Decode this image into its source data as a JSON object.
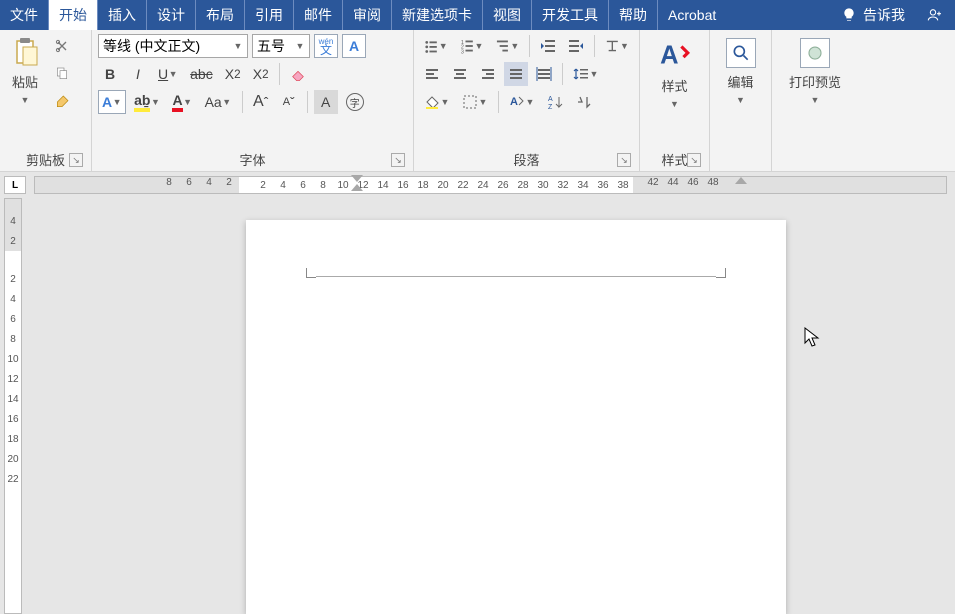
{
  "tabs": {
    "file": "文件",
    "home": "开始",
    "insert": "插入",
    "design": "设计",
    "layout": "布局",
    "references": "引用",
    "mailings": "邮件",
    "review": "审阅",
    "newtab": "新建选项卡",
    "view": "视图",
    "developer": "开发工具",
    "help": "帮助",
    "acrobat": "Acrobat",
    "tellme": "告诉我"
  },
  "groups": {
    "clipboard": {
      "label": "剪贴板",
      "paste": "粘贴"
    },
    "font": {
      "label": "字体",
      "name": "等线 (中文正文)",
      "size": "五号",
      "phonetic_top": "wén",
      "phonetic_bottom": "文",
      "charborder": "A",
      "bold": "B",
      "italic": "I",
      "underline": "U",
      "strike": "abc",
      "sub": "2",
      "sup2": "2",
      "texteffect": "A",
      "highlight": "aḇ",
      "fontcolor": "A",
      "changecase": "Aa",
      "grow": "A",
      "shrink": "A",
      "charshade": "A",
      "enclose": "字"
    },
    "paragraph": {
      "label": "段落"
    },
    "styles": {
      "label": "样式",
      "button": "样式"
    },
    "editing": {
      "button": "编辑"
    },
    "printpreview": {
      "button": "打印预览"
    }
  },
  "ruler": {
    "h_left": [
      "8",
      "6",
      "4",
      "2"
    ],
    "h_main": [
      "2",
      "4",
      "6",
      "8",
      "10",
      "12",
      "14",
      "16",
      "18",
      "20",
      "22",
      "24",
      "26",
      "28",
      "30",
      "32",
      "34",
      "36",
      "38"
    ],
    "h_right": [
      "42",
      "44",
      "46",
      "48"
    ],
    "v_top": [
      "4",
      "2"
    ],
    "v_main": [
      "2",
      "4",
      "6",
      "8",
      "10",
      "12",
      "14",
      "16",
      "18",
      "20",
      "22"
    ]
  },
  "corner": "L"
}
